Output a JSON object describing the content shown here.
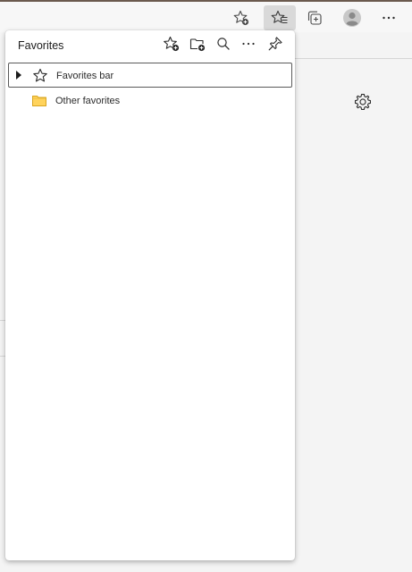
{
  "toolbar": {
    "buttons": [
      {
        "icon": "add-favorite-icon",
        "active": false
      },
      {
        "icon": "favorites-icon",
        "active": true
      },
      {
        "icon": "collections-icon",
        "active": false
      },
      {
        "icon": "profile-icon",
        "active": false
      },
      {
        "icon": "more-icon",
        "active": false
      }
    ]
  },
  "page": {
    "settings_icon": "gear-icon"
  },
  "favorites_panel": {
    "title": "Favorites",
    "header_buttons": [
      {
        "icon": "add-this-page-to-favorites-icon"
      },
      {
        "icon": "add-folder-icon"
      },
      {
        "icon": "search-icon"
      },
      {
        "icon": "more-options-icon"
      },
      {
        "icon": "pin-icon"
      }
    ],
    "items": [
      {
        "label": "Favorites bar",
        "icon": "star-icon",
        "expandable": true,
        "selected": true
      },
      {
        "label": "Other favorites",
        "icon": "folder-icon",
        "expandable": false,
        "selected": false
      }
    ]
  },
  "colors": {
    "accent_active": "#d9d9d9",
    "folder_fill": "#ffd35c",
    "folder_stroke": "#d9a520",
    "selection_border": "#5a5a5a"
  }
}
